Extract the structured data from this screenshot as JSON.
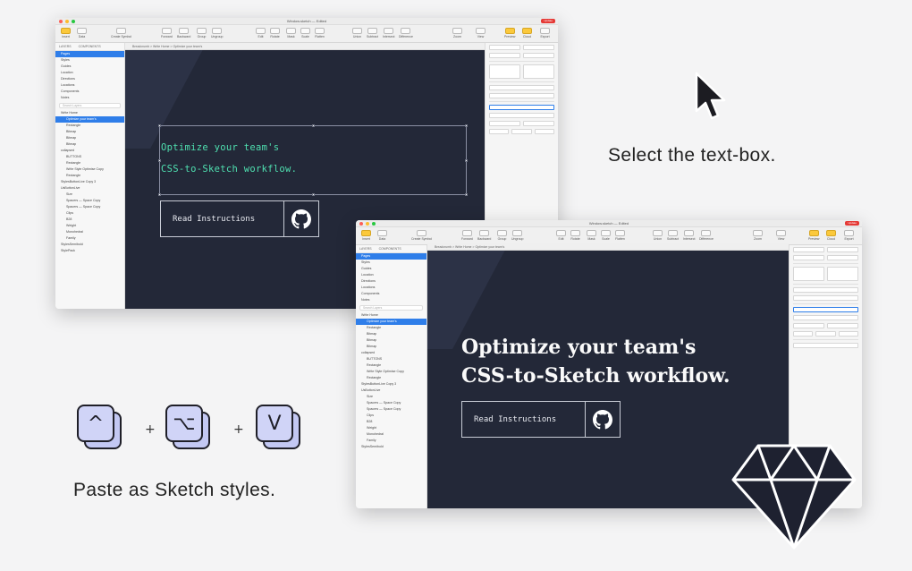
{
  "captions": {
    "select": "Select the text-box.",
    "paste": "Paste as Sketch styles."
  },
  "shortcut": {
    "keys": [
      "^",
      "⌥",
      "V"
    ],
    "plus": "+"
  },
  "cursor_icon": "arrow-cursor-icon",
  "logo_icon": "sketch-diamond-icon",
  "colors": {
    "artboard": "#232838",
    "mono_text": "#4fe0b0",
    "key_fill": "#d0d4f7",
    "selection": "#2f7ee9"
  },
  "window_before": {
    "doc_title": "Window.sketch — Edited",
    "badge": "Update",
    "toolbar": [
      "Insert",
      "Data",
      "Create Symbol",
      "Forward",
      "Backward",
      "Group",
      "Ungroup",
      "Edit",
      "Rotate",
      "Mask",
      "Scale",
      "Flatten",
      "Union",
      "Subtract",
      "Intersect",
      "Difference",
      "Zoom",
      "View",
      "Preview",
      "Cloud",
      "Export"
    ],
    "sidebar_tabs": [
      "LAYERS",
      "COMPONENTS"
    ],
    "pages": [
      "Pages",
      "Styles",
      "Guides",
      "Location",
      "Directions",
      "Locations",
      "Components",
      "Notes"
    ],
    "search_placeholder": "Search Layers",
    "layers": [
      "Write Home",
      "Optimize your team's",
      "Rectangle",
      "Bitmap",
      "Bitmap",
      "Bitmap",
      "collapsed",
      "BUTTONS",
      "Rectangle",
      "Write Style Optimise Copy",
      "Rectangle",
      "StylesButtonLive Copy 3",
      "UsButtonLive",
      "Size",
      "Spacers — Space Copy",
      "Spacers — Space Copy",
      "Clips",
      "B28",
      "Weight",
      "Monohedral",
      "Family",
      "StylesSemibold",
      "StylePack"
    ],
    "crumb": "Breadcrumb > Write Home > Optimize your team's",
    "headline": [
      "Optimize your team's",
      "CSS-to-Sketch workflow."
    ],
    "cta": "Read Instructions"
  },
  "window_after": {
    "doc_title": "Window.sketch — Edited",
    "badge": "Update",
    "headline": [
      "Optimize your team's",
      "CSS-to-Sketch workflow."
    ],
    "cta": "Read Instructions"
  }
}
